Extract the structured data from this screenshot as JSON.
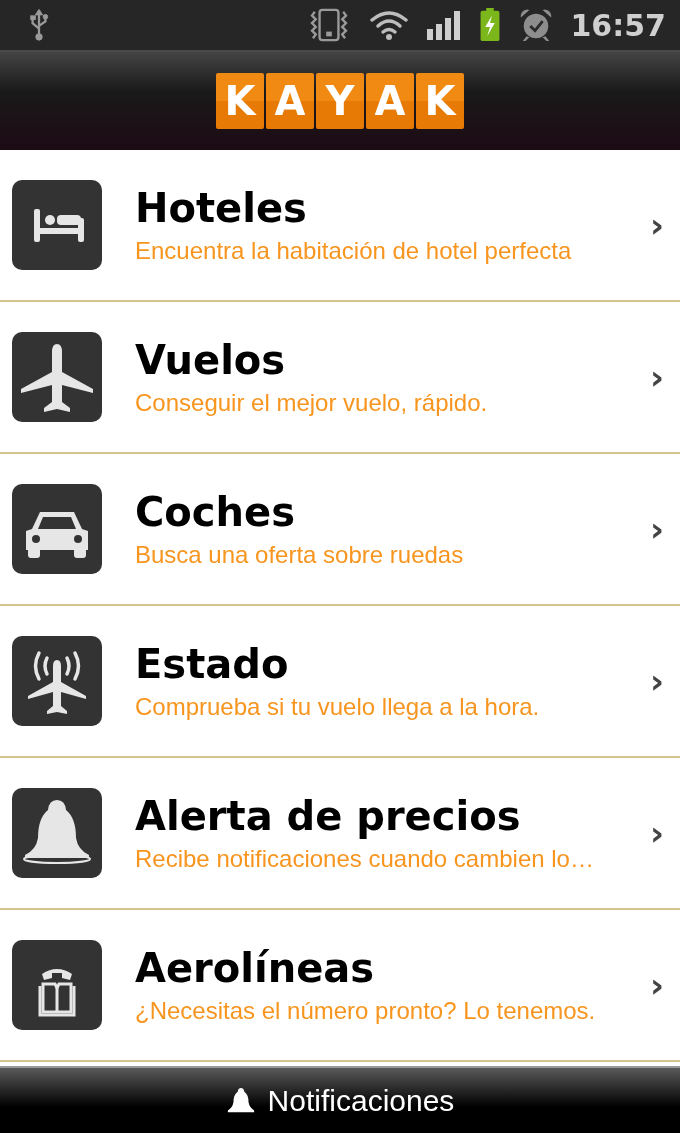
{
  "status_bar": {
    "time": "16:57"
  },
  "header": {
    "logo_letters": [
      "K",
      "A",
      "Y",
      "A",
      "K"
    ]
  },
  "menu": [
    {
      "title": "Hoteles",
      "subtitle": "Encuentra la habitación de hotel perfecta",
      "chevron": "›"
    },
    {
      "title": "Vuelos",
      "subtitle": "Conseguir el mejor vuelo, rápido.",
      "chevron": "›"
    },
    {
      "title": "Coches",
      "subtitle": "Busca una oferta sobre ruedas",
      "chevron": "›"
    },
    {
      "title": "Estado",
      "subtitle": "Comprueba si tu vuelo llega a la hora.",
      "chevron": "›"
    },
    {
      "title": "Alerta de precios",
      "subtitle": "Recibe notificaciones cuando cambien lo…",
      "chevron": "›"
    },
    {
      "title": "Aerolíneas",
      "subtitle": "¿Necesitas el número pronto? Lo tenemos.",
      "chevron": "›"
    }
  ],
  "bottom_bar": {
    "label": "Notificaciones"
  }
}
